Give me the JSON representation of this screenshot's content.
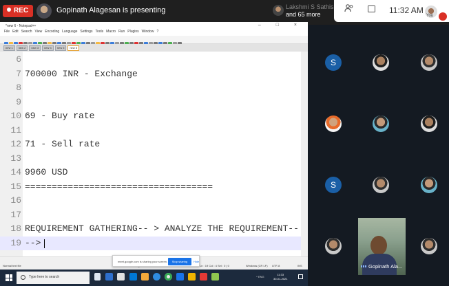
{
  "meet": {
    "rec_label": "REC",
    "presenting_text": "Gopinath Alagesan is presenting",
    "others_line1": "Lakshmi S Sathish",
    "others_line2": "and 65 more",
    "clock": "11:32 AM",
    "you_label": "You"
  },
  "notepad": {
    "title": "*new 6 - Notepad++",
    "window_controls": "– □ ×",
    "menu": [
      "File",
      "Edit",
      "Search",
      "View",
      "Encoding",
      "Language",
      "Settings",
      "Tools",
      "Macro",
      "Run",
      "Plugins",
      "Window",
      "?"
    ],
    "tabs": [
      "new 1",
      "new 2",
      "new 3",
      "new 4",
      "new 5",
      "new 6"
    ],
    "active_tab_index": 5,
    "lines": [
      {
        "n": "6",
        "text": ""
      },
      {
        "n": "7",
        "text": "700000 INR - Exchange"
      },
      {
        "n": "8",
        "text": ""
      },
      {
        "n": "9",
        "text": ""
      },
      {
        "n": "10",
        "text": "69 - Buy rate"
      },
      {
        "n": "11",
        "text": ""
      },
      {
        "n": "12",
        "text": "71 - Sell rate"
      },
      {
        "n": "13",
        "text": ""
      },
      {
        "n": "14",
        "text": "9960 USD"
      },
      {
        "n": "15",
        "text": "==================================="
      },
      {
        "n": "16",
        "text": ""
      },
      {
        "n": "17",
        "text": ""
      },
      {
        "n": "18",
        "text": "REQUIREMENT GATHERING-- > ANALYZE THE REQUIREMENT--"
      },
      {
        "n": "19",
        "text": "-->"
      }
    ],
    "current_line_index": 13,
    "status_left": "Normal text file",
    "status_mid": "length : 244   lines : 24",
    "status_pos": "Ln : 19   Col : 4   Sel : 0 | 0",
    "status_eol": "Windows (CR LF)",
    "status_enc": "UTF-8",
    "status_ins": "INS"
  },
  "share_notice": {
    "message": "meet.google.com is sharing your screen.",
    "stop_label": "Stop sharing",
    "hide_label": "Hide"
  },
  "taskbar": {
    "search_placeholder": "Type here to search",
    "tray_text": "^ ENG",
    "time": "11:33",
    "date": "30-01-2021"
  },
  "participants": {
    "tiles": [
      {
        "type": "initial",
        "label": "S"
      },
      {
        "type": "photo",
        "style": "dark"
      },
      {
        "type": "photo",
        "style": "grey"
      },
      {
        "type": "photo",
        "style": "orange"
      },
      {
        "type": "photo",
        "style": "teal"
      },
      {
        "type": "photo",
        "style": "dark"
      },
      {
        "type": "initial",
        "label": "S"
      },
      {
        "type": "photo",
        "style": "grey"
      },
      {
        "type": "photo",
        "style": "teal"
      },
      {
        "type": "photo",
        "style": "grey"
      },
      {
        "type": "photo",
        "style": "grey"
      }
    ],
    "camera_tile_name": "Gopinath Ala..."
  },
  "colors": {
    "rec_red": "#d93025",
    "initial_tile_blue": "#1a5fa6",
    "stop_sharing_blue": "#1a73e8",
    "current_line": "#e8e8ff",
    "taskbar": "#1c2a3d"
  }
}
